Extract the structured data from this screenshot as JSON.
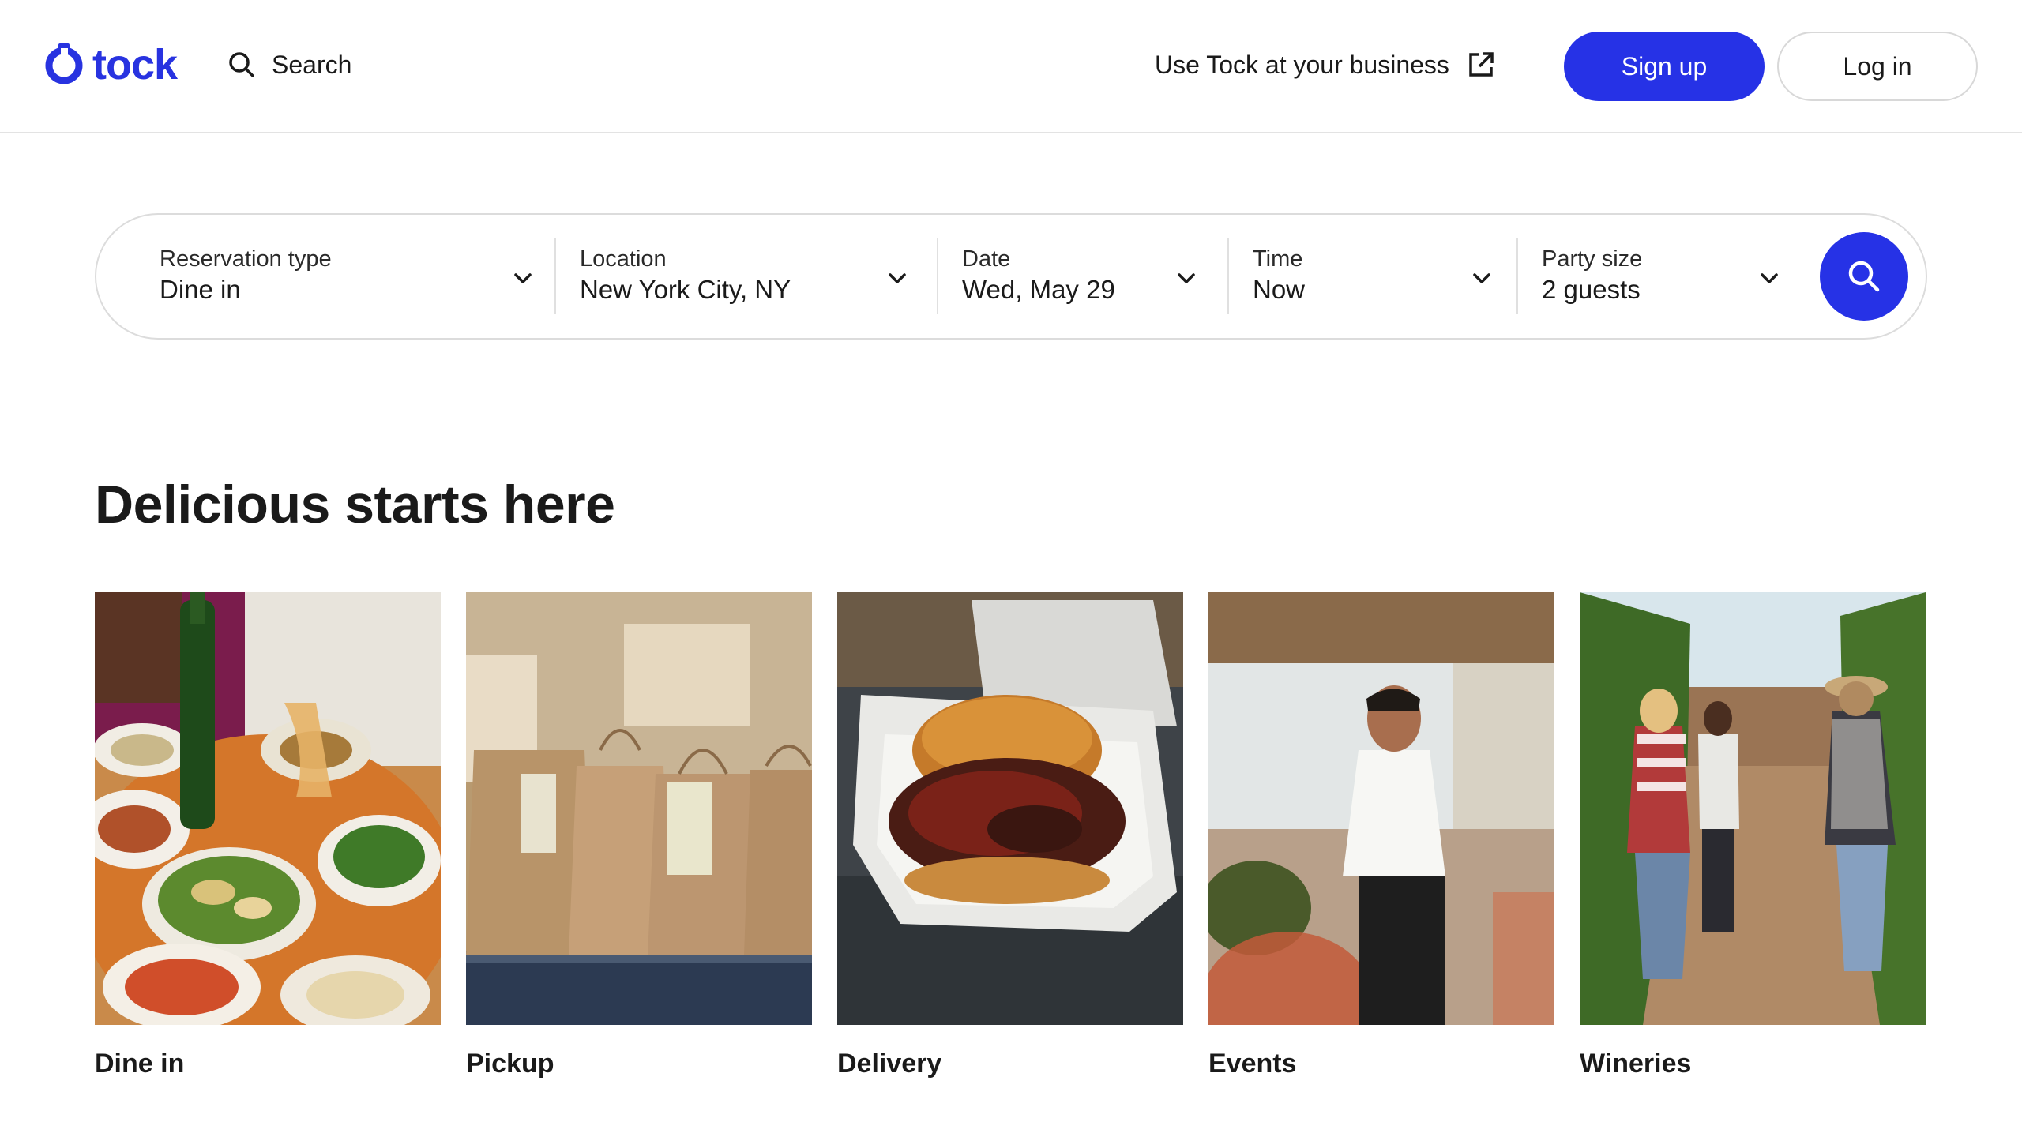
{
  "header": {
    "logo_text": "tock",
    "search_label": "Search",
    "business_label": "Use Tock at your business",
    "signup_label": "Sign up",
    "login_label": "Log in"
  },
  "searchbar": {
    "fields": [
      {
        "label": "Reservation type",
        "value": "Dine in"
      },
      {
        "label": "Location",
        "value": "New York City, NY"
      },
      {
        "label": "Date",
        "value": "Wed, May 29"
      },
      {
        "label": "Time",
        "value": "Now"
      },
      {
        "label": "Party size",
        "value": "2 guests"
      }
    ]
  },
  "main": {
    "title": "Delicious starts here",
    "categories": [
      {
        "label": "Dine in",
        "image": "dining-table-photo"
      },
      {
        "label": "Pickup",
        "image": "takeout-bags-photo"
      },
      {
        "label": "Delivery",
        "image": "burger-container-photo"
      },
      {
        "label": "Events",
        "image": "chef-event-photo"
      },
      {
        "label": "Wineries",
        "image": "vineyard-walk-photo"
      }
    ]
  },
  "colors": {
    "brand": "#2632e6",
    "text": "#1a1a1a",
    "border": "#dcdcdc"
  },
  "icons": [
    "tock-logo-icon",
    "search-icon",
    "external-link-icon",
    "chevron-down-icon"
  ]
}
